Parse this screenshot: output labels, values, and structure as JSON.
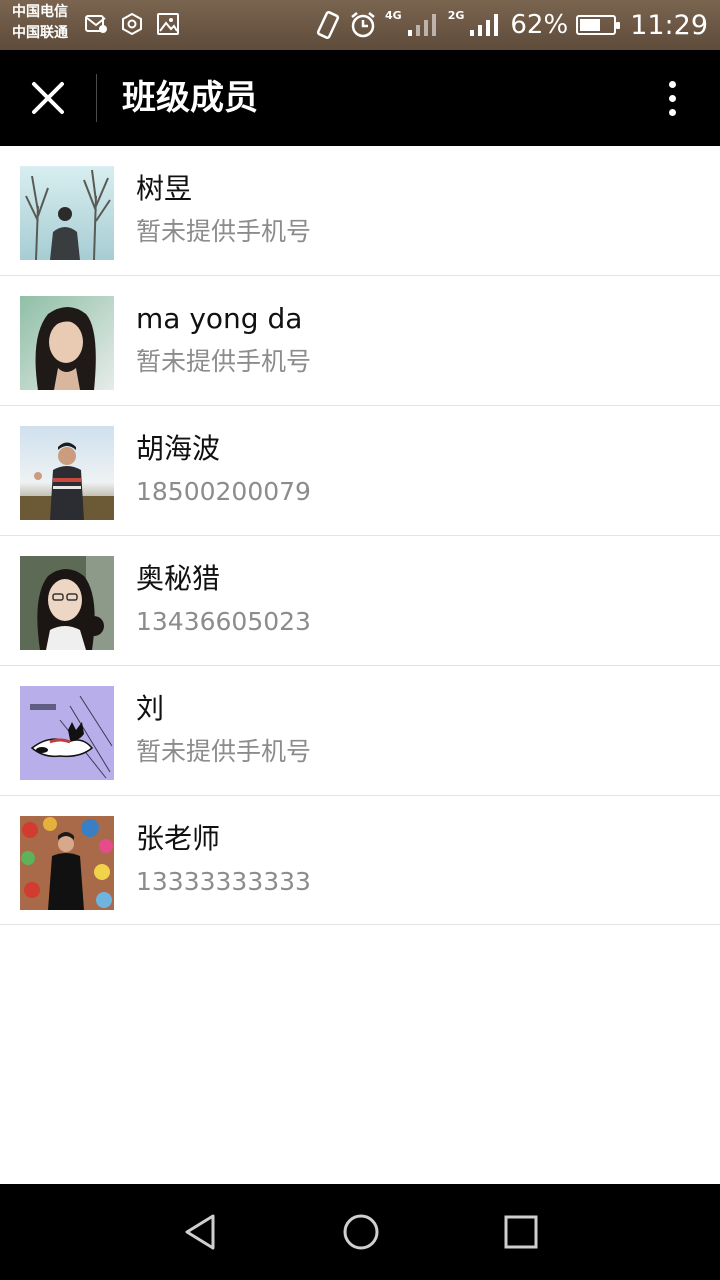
{
  "status_bar": {
    "carrier_1": "中国电信",
    "carrier_2": "中国联通",
    "network_1": "4G",
    "network_2": "2G",
    "battery_percent": "62%",
    "battery_level": 0.62,
    "time": "11:29"
  },
  "header": {
    "title": "班级成员",
    "close_icon": "close-icon",
    "more_icon": "more-vertical-icon"
  },
  "members": [
    {
      "name": "树昱",
      "phone": "暂未提供手机号"
    },
    {
      "name": "ma yong da",
      "phone": "暂未提供手机号"
    },
    {
      "name": "胡海波",
      "phone": "18500200079"
    },
    {
      "name": "奥秘猎",
      "phone": "13436605023"
    },
    {
      "name": "刘",
      "phone": "暂未提供手机号"
    },
    {
      "name": "张老师",
      "phone": "13333333333"
    }
  ],
  "nav_bar": {
    "back_icon": "back-triangle-icon",
    "home_icon": "home-circle-icon",
    "recents_icon": "recents-square-icon"
  },
  "colors": {
    "title_bar": "#000000",
    "status_bar": "#6b5644",
    "name_text": "#111111",
    "phone_text": "#8c8c8c",
    "divider": "#e3e3e3"
  }
}
